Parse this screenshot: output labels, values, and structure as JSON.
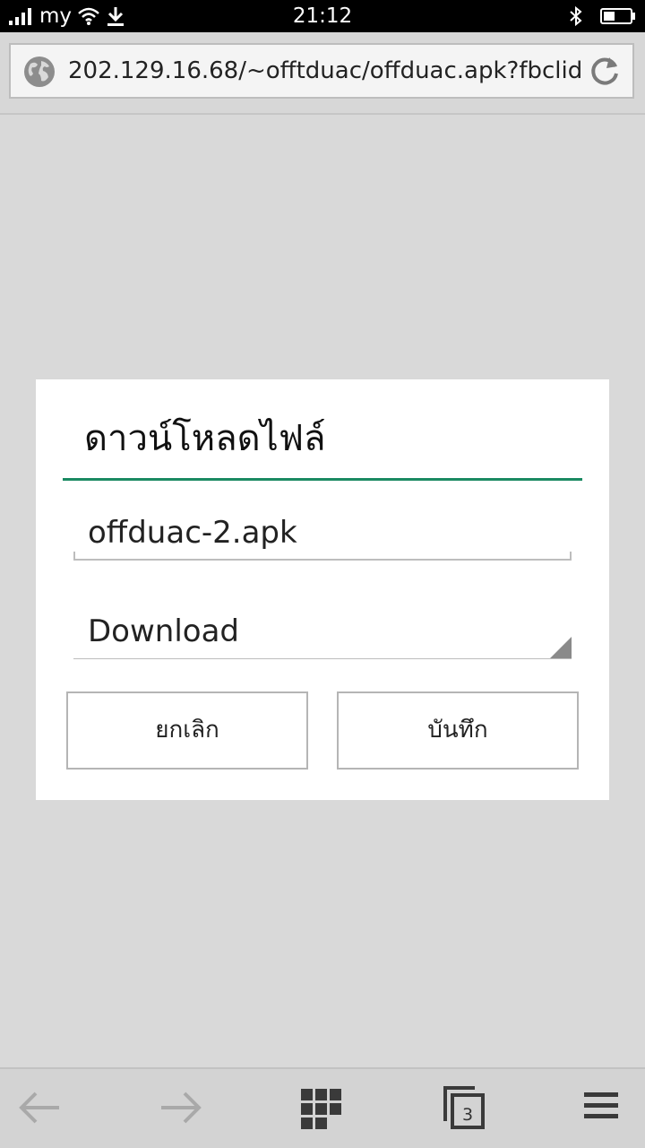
{
  "status_bar": {
    "carrier": "my",
    "time": "21:12",
    "icons": [
      "signal-icon",
      "wifi-icon",
      "download-icon",
      "bluetooth-icon",
      "battery-icon"
    ]
  },
  "browser": {
    "url": "202.129.16.68/~offtduac/offduac.apk?fbclid=",
    "icons": [
      "globe-icon",
      "reload-icon"
    ]
  },
  "dialog": {
    "title": "ดาวน์โหลดไฟล์",
    "filename": "offduac-2.apk",
    "folder": "Download",
    "cancel_label": "ยกเลิก",
    "save_label": "บันทึก",
    "accent_color": "#1a8a62"
  },
  "toolbar": {
    "tabs_count": "3",
    "icons": [
      "back-arrow-icon",
      "forward-arrow-icon",
      "grid-icon",
      "tabs-icon",
      "menu-icon"
    ]
  }
}
